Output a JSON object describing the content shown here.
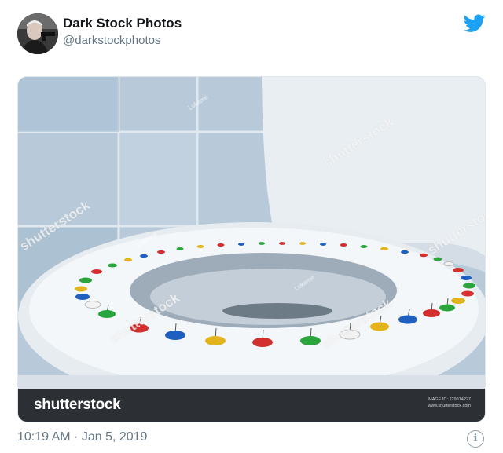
{
  "tweet": {
    "author_name": "Dark Stock Photos",
    "author_handle": "@darkstockphotos",
    "timestamp": "10:19 AM · Jan 5, 2019",
    "brand_icon": "twitter-bird-icon",
    "info_icon": "info-icon",
    "colors": {
      "brand": "#1da1f2",
      "secondary_text": "#657786"
    }
  },
  "photo": {
    "stock_brand": "shutterstock",
    "stock_id_line1": "IMAGE ID: 229914227",
    "stock_id_line2": "www.shutterstock.com",
    "watermark": "shutterstock",
    "watermark_small": "Lukame"
  }
}
